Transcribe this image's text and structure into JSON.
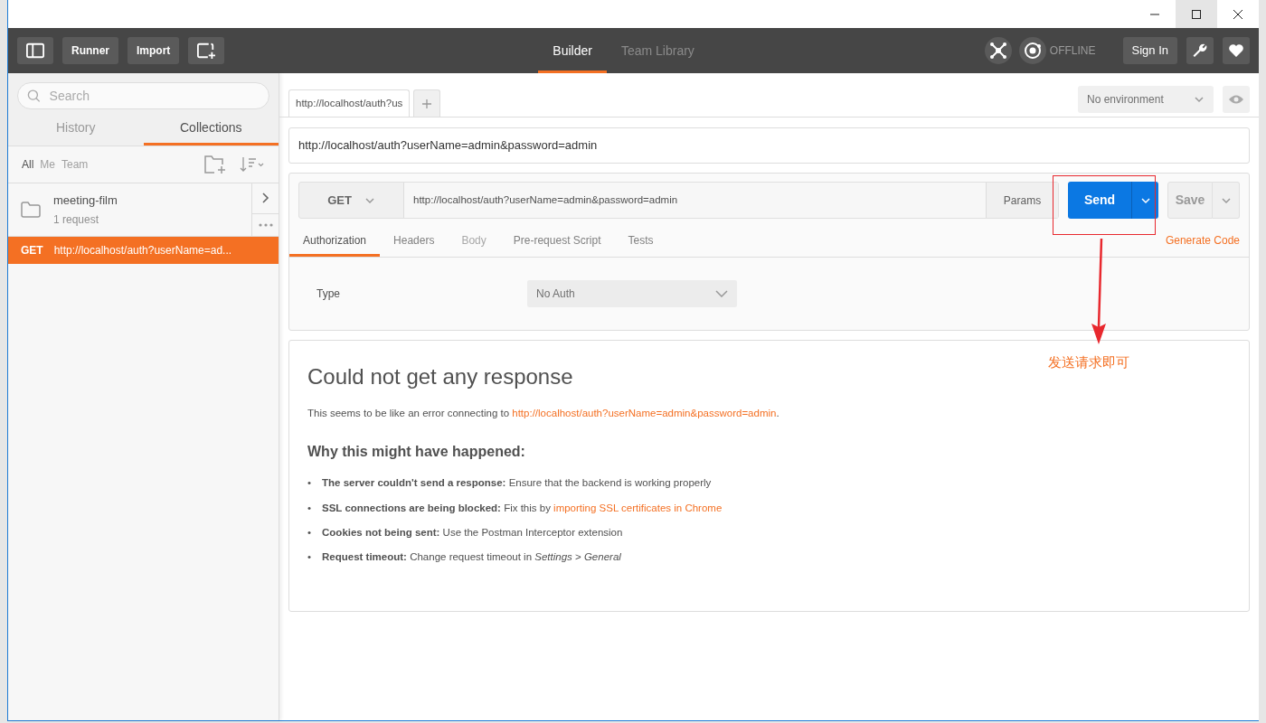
{
  "toolbar": {
    "buttons": [
      "Runner",
      "Import"
    ],
    "nav": [
      {
        "label": "Builder",
        "selected": true
      },
      {
        "label": "Team Library",
        "selected": false
      }
    ],
    "status": "OFFLINE",
    "sign_in": "Sign In"
  },
  "sidebar": {
    "search": {
      "placeholder": "Search"
    },
    "tabs": [
      {
        "label": "History",
        "selected": false
      },
      {
        "label": "Collections",
        "selected": true
      }
    ],
    "filters": [
      {
        "label": "All",
        "selected": true
      },
      {
        "label": "Me",
        "selected": false
      },
      {
        "label": "Team",
        "selected": false
      }
    ],
    "collections": [
      {
        "name": "meeting-film",
        "count": "1 request"
      }
    ],
    "requests": [
      {
        "method": "GET",
        "url": "http://localhost/auth?userName=ad...",
        "selected": true
      }
    ]
  },
  "request_tabs": [
    {
      "label": "http://localhost/auth?us",
      "selected": true
    }
  ],
  "environment": "No environment",
  "request": {
    "title": "http://localhost/auth?userName=admin&password=admin",
    "method": "GET",
    "url": "http://localhost/auth?userName=admin&password=admin",
    "params": "Params",
    "send": "Send",
    "save": "Save",
    "tabs": [
      {
        "label": "Authorization",
        "selected": true,
        "disabled": false
      },
      {
        "label": "Headers",
        "selected": false,
        "disabled": false
      },
      {
        "label": "Body",
        "selected": false,
        "disabled": true
      },
      {
        "label": "Pre-request Script",
        "selected": false,
        "disabled": false
      },
      {
        "label": "Tests",
        "selected": false,
        "disabled": false
      }
    ],
    "generate_code": "Generate Code",
    "auth": {
      "label": "Type",
      "value": "No Auth"
    }
  },
  "response": {
    "title": "Could not get any response",
    "message": "This seems to be like an error connecting to",
    "message_link": "http://localhost/auth?userName=admin&password=admin",
    "message_end": ".",
    "heading": "Why this might have happened:",
    "reasons": [
      {
        "bullet": "•",
        "label": "The server couldn't send a response:",
        "text": "Ensure that the backend is working properly"
      },
      {
        "bullet": "•",
        "label": "SSL connections are being blocked:",
        "text": "Fix this by",
        "link": "importing SSL certificates in Chrome"
      },
      {
        "bullet": "•",
        "label": "Cookies not being sent:",
        "text": "Use the Postman Interceptor extension"
      },
      {
        "bullet": "•",
        "label": "Request timeout:",
        "text": "Change request timeout in *Settings* > *General*"
      }
    ]
  },
  "annotation": {
    "text": "发送请求即可"
  }
}
